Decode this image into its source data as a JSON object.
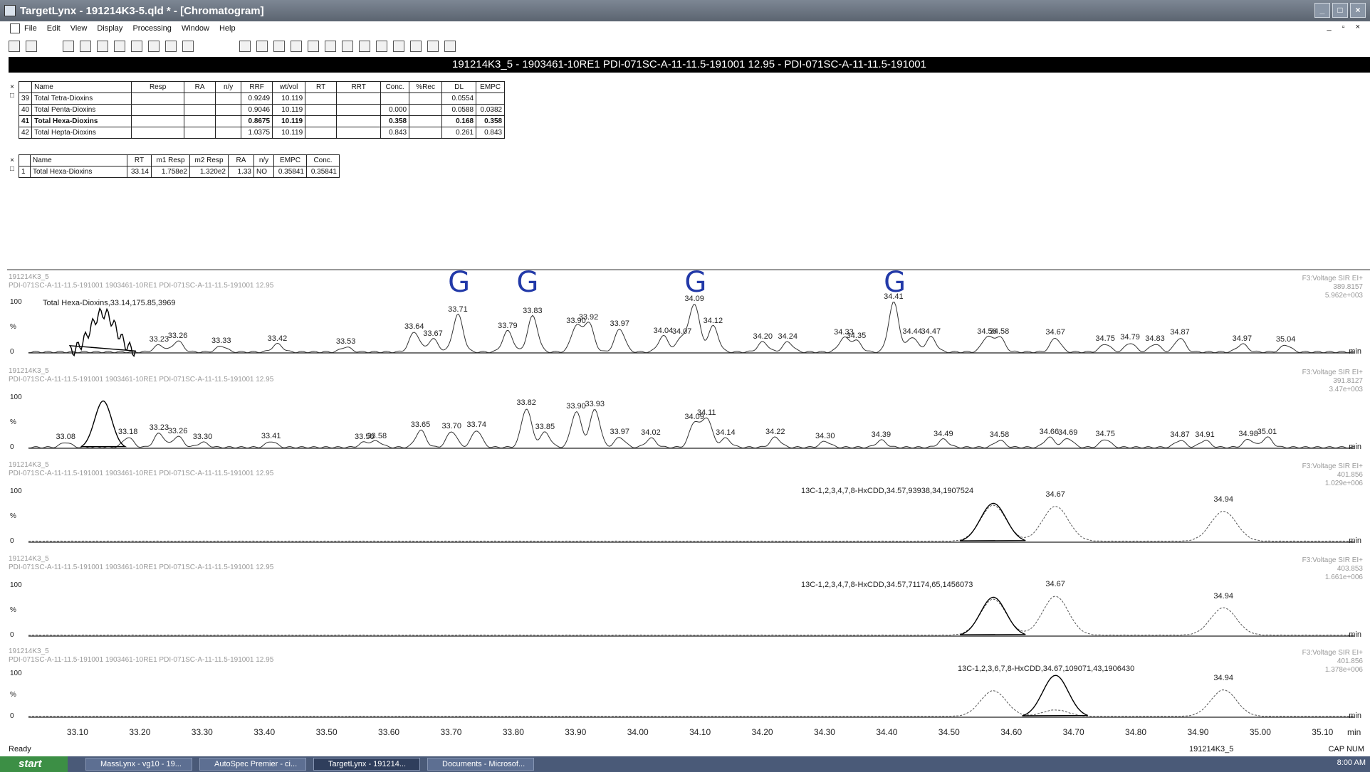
{
  "window": {
    "title": "TargetLynx - 191214K3-5.qld * - [Chromatogram]",
    "buttons": [
      "_",
      "□",
      "×"
    ]
  },
  "menu": [
    "File",
    "Edit",
    "View",
    "Display",
    "Processing",
    "Window",
    "Help"
  ],
  "mdi_buttons": "_ ▫ ×",
  "infobar": "191214K3_5 - 1903461-10RE1 PDI-071SC-A-11-11.5-191001 12.95 - PDI-071SC-A-11-11.5-191001",
  "table1": {
    "headers": [
      "",
      "Name",
      "Resp",
      "RA",
      "n/y",
      "RRF",
      "wt/vol",
      "RT",
      "RRT",
      "Conc.",
      "%Rec",
      "DL",
      "EMPC"
    ],
    "rows": [
      [
        "39",
        "Total Tetra-Dioxins",
        "",
        "",
        "",
        "0.9249",
        "10.119",
        "",
        "",
        "",
        "",
        "0.0554",
        ""
      ],
      [
        "40",
        "Total Penta-Dioxins",
        "",
        "",
        "",
        "0.9046",
        "10.119",
        "",
        "",
        "0.000",
        "",
        "0.0588",
        "0.0382"
      ],
      [
        "41",
        "Total Hexa-Dioxins",
        "",
        "",
        "",
        "0.8675",
        "10.119",
        "",
        "",
        "0.358",
        "",
        "0.168",
        "0.358"
      ],
      [
        "42",
        "Total Hepta-Dioxins",
        "",
        "",
        "",
        "1.0375",
        "10.119",
        "",
        "",
        "0.843",
        "",
        "0.261",
        "0.843"
      ]
    ]
  },
  "table2": {
    "headers": [
      "",
      "Name",
      "RT",
      "m1 Resp",
      "m2 Resp",
      "RA",
      "n/y",
      "EMPC",
      "Conc."
    ],
    "rows": [
      [
        "1",
        "Total Hexa-Dioxins",
        "33.14",
        "1.758e2",
        "1.320e2",
        "1.33",
        "NO",
        "0.35841",
        "0.35841"
      ]
    ]
  },
  "panels": [
    {
      "header1": "191214K3_5",
      "header2": "PDI-071SC-A-11-11.5-191001 1903461-10RE1 PDI-071SC-A-11-11.5-191001 12.95",
      "right1": "F3:Voltage SIR EI+",
      "right2": "389.8157",
      "right3": "5.962e+003",
      "compound": "Total Hexa-Dioxins,33.14,175.85,3969",
      "peaks": [
        {
          "rt": "33.23",
          "x": 33.23,
          "h": 0.14
        },
        {
          "rt": "33.26",
          "x": 33.26,
          "h": 0.22
        },
        {
          "rt": "33.33",
          "x": 33.33,
          "h": 0.12
        },
        {
          "rt": "33.42",
          "x": 33.42,
          "h": 0.16
        },
        {
          "rt": "33.53",
          "x": 33.53,
          "h": 0.1
        },
        {
          "rt": "33.64",
          "x": 33.64,
          "h": 0.4
        },
        {
          "rt": "33.67",
          "x": 33.67,
          "h": 0.26
        },
        {
          "rt": "33.71",
          "x": 33.71,
          "h": 0.75
        },
        {
          "rt": "33.79",
          "x": 33.79,
          "h": 0.42
        },
        {
          "rt": "33.83",
          "x": 33.83,
          "h": 0.72
        },
        {
          "rt": "33.90",
          "x": 33.9,
          "h": 0.52
        },
        {
          "rt": "33.92",
          "x": 33.92,
          "h": 0.58
        },
        {
          "rt": "33.97",
          "x": 33.97,
          "h": 0.46
        },
        {
          "rt": "34.04",
          "x": 34.04,
          "h": 0.32
        },
        {
          "rt": "34.07",
          "x": 34.07,
          "h": 0.3
        },
        {
          "rt": "34.09",
          "x": 34.09,
          "h": 0.96
        },
        {
          "rt": "34.12",
          "x": 34.12,
          "h": 0.52
        },
        {
          "rt": "34.20",
          "x": 34.2,
          "h": 0.2
        },
        {
          "rt": "34.24",
          "x": 34.24,
          "h": 0.2
        },
        {
          "rt": "34.33",
          "x": 34.33,
          "h": 0.28
        },
        {
          "rt": "34.35",
          "x": 34.35,
          "h": 0.22
        },
        {
          "rt": "34.41",
          "x": 34.41,
          "h": 1.0
        },
        {
          "rt": "34.44",
          "x": 34.44,
          "h": 0.3
        },
        {
          "rt": "34.47",
          "x": 34.47,
          "h": 0.3
        },
        {
          "rt": "34.56",
          "x": 34.56,
          "h": 0.3
        },
        {
          "rt": "34.58",
          "x": 34.58,
          "h": 0.3
        },
        {
          "rt": "34.67",
          "x": 34.67,
          "h": 0.28
        },
        {
          "rt": "34.75",
          "x": 34.75,
          "h": 0.16
        },
        {
          "rt": "34.79",
          "x": 34.79,
          "h": 0.18
        },
        {
          "rt": "34.83",
          "x": 34.83,
          "h": 0.16
        },
        {
          "rt": "34.87",
          "x": 34.87,
          "h": 0.28
        },
        {
          "rt": "34.97",
          "x": 34.97,
          "h": 0.16
        },
        {
          "rt": "35.04",
          "x": 35.04,
          "h": 0.14
        }
      ],
      "g_marks": [
        {
          "text": "G",
          "x": 33.71
        },
        {
          "text": "G",
          "x": 33.82
        },
        {
          "text": "G",
          "x": 34.09
        },
        {
          "text": "G",
          "x": 34.41
        }
      ]
    },
    {
      "header1": "191214K3_5",
      "header2": "PDI-071SC-A-11-11.5-191001 1903461-10RE1 PDI-071SC-A-11-11.5-191001 12.95",
      "right1": "F3:Voltage SIR EI+",
      "right2": "391.8127",
      "right3": "3.47e+003",
      "peaks": [
        {
          "rt": "33.08",
          "x": 33.08,
          "h": 0.1
        },
        {
          "rt": "33.18",
          "x": 33.18,
          "h": 0.2
        },
        {
          "rt": "33.23",
          "x": 33.23,
          "h": 0.28
        },
        {
          "rt": "33.26",
          "x": 33.26,
          "h": 0.22
        },
        {
          "rt": "33.30",
          "x": 33.3,
          "h": 0.1
        },
        {
          "rt": "33.41",
          "x": 33.41,
          "h": 0.12
        },
        {
          "rt": "33.56",
          "x": 33.56,
          "h": 0.1
        },
        {
          "rt": "33.58",
          "x": 33.58,
          "h": 0.12
        },
        {
          "rt": "33.65",
          "x": 33.65,
          "h": 0.34
        },
        {
          "rt": "33.70",
          "x": 33.7,
          "h": 0.32
        },
        {
          "rt": "33.74",
          "x": 33.74,
          "h": 0.34
        },
        {
          "rt": "33.82",
          "x": 33.82,
          "h": 0.78
        },
        {
          "rt": "33.85",
          "x": 33.85,
          "h": 0.3
        },
        {
          "rt": "33.90",
          "x": 33.9,
          "h": 0.72
        },
        {
          "rt": "33.93",
          "x": 33.93,
          "h": 0.76
        },
        {
          "rt": "33.97",
          "x": 33.97,
          "h": 0.2
        },
        {
          "rt": "34.02",
          "x": 34.02,
          "h": 0.18
        },
        {
          "rt": "34.09",
          "x": 34.09,
          "h": 0.5
        },
        {
          "rt": "34.11",
          "x": 34.11,
          "h": 0.58
        },
        {
          "rt": "34.14",
          "x": 34.14,
          "h": 0.18
        },
        {
          "rt": "34.22",
          "x": 34.22,
          "h": 0.2
        },
        {
          "rt": "34.30",
          "x": 34.3,
          "h": 0.12
        },
        {
          "rt": "34.39",
          "x": 34.39,
          "h": 0.14
        },
        {
          "rt": "34.49",
          "x": 34.49,
          "h": 0.16
        },
        {
          "rt": "34.58",
          "x": 34.58,
          "h": 0.14
        },
        {
          "rt": "34.66",
          "x": 34.66,
          "h": 0.2
        },
        {
          "rt": "34.69",
          "x": 34.69,
          "h": 0.18
        },
        {
          "rt": "34.75",
          "x": 34.75,
          "h": 0.16
        },
        {
          "rt": "34.87",
          "x": 34.87,
          "h": 0.14
        },
        {
          "rt": "34.91",
          "x": 34.91,
          "h": 0.14
        },
        {
          "rt": "34.98",
          "x": 34.98,
          "h": 0.16
        },
        {
          "rt": "35.01",
          "x": 35.01,
          "h": 0.2
        }
      ]
    },
    {
      "header1": "191214K3_5",
      "header2": "PDI-071SC-A-11-11.5-191001 1903461-10RE1 PDI-071SC-A-11-11.5-191001 12.95",
      "right1": "F3:Voltage SIR EI+",
      "right2": "401.856",
      "right3": "1.029e+006",
      "compound": "13C-1,2,3,4,7,8-HxCDD,34.57,93938,34,1907524",
      "peaks": [
        {
          "rt": "34.67",
          "x": 34.67,
          "h": 0.7
        },
        {
          "rt": "34.94",
          "x": 34.94,
          "h": 0.6
        }
      ]
    },
    {
      "header1": "191214K3_5",
      "header2": "PDI-071SC-A-11-11.5-191001 1903461-10RE1 PDI-071SC-A-11-11.5-191001 12.95",
      "right1": "F3:Voltage SIR EI+",
      "right2": "403.853",
      "right3": "1.661e+006",
      "compound": "13C-1,2,3,4,7,8-HxCDD,34.57,71174,65,1456073",
      "peaks": [
        {
          "rt": "34.67",
          "x": 34.67,
          "h": 0.78
        },
        {
          "rt": "34.94",
          "x": 34.94,
          "h": 0.55
        }
      ]
    },
    {
      "header1": "191214K3_5",
      "header2": "PDI-071SC-A-11-11.5-191001 1903461-10RE1 PDI-071SC-A-11-11.5-191001 12.95",
      "right1": "F3:Voltage SIR EI+",
      "right2": "401.856",
      "right3": "1.378e+006",
      "compound": "13C-1,2,3,6,7,8-HxCDD,34.67,109071,43,1906430",
      "peaks": [
        {
          "rt": "34.94",
          "x": 34.94,
          "h": 0.62
        }
      ]
    }
  ],
  "y_ticks": [
    "100",
    "%",
    "0"
  ],
  "x_axis_label": "min",
  "x_ticks": [
    "33.10",
    "33.20",
    "33.30",
    "33.40",
    "33.50",
    "33.60",
    "33.70",
    "33.80",
    "33.90",
    "34.00",
    "34.10",
    "34.20",
    "34.30",
    "34.40",
    "34.50",
    "34.60",
    "34.70",
    "34.80",
    "34.90",
    "35.00",
    "35.10"
  ],
  "x_range": [
    33.02,
    35.15
  ],
  "status": {
    "left": "Ready",
    "file": "191214K3_5",
    "right": "CAP  NUM"
  },
  "taskbar": {
    "start": "start",
    "tasks": [
      "MassLynx - vg10 - 19...",
      "AutoSpec Premier - ci...",
      "TargetLynx - 191214...",
      "Documents - Microsof..."
    ],
    "clock": "8:00 AM"
  }
}
